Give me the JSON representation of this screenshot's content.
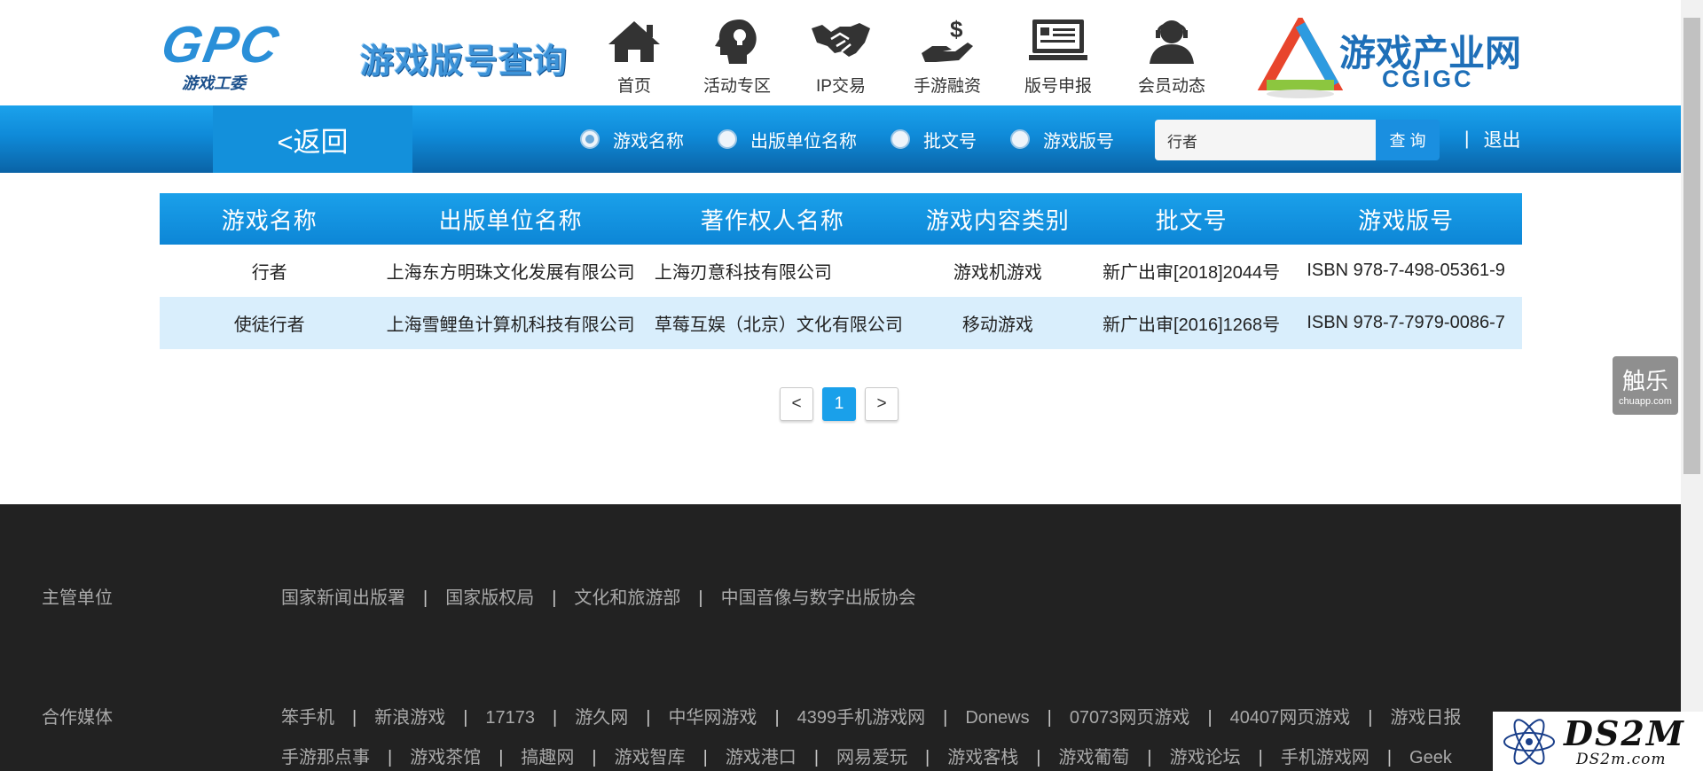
{
  "header": {
    "logo_letters": "GPC",
    "logo_sub": "游戏工委",
    "site_title": "游戏版号查询",
    "nav": [
      {
        "label": "首页",
        "icon": "home-icon"
      },
      {
        "label": "活动专区",
        "icon": "head-idea-icon"
      },
      {
        "label": "IP交易",
        "icon": "handshake-icon"
      },
      {
        "label": "手游融资",
        "icon": "money-hand-icon"
      },
      {
        "label": "版号申报",
        "icon": "monitor-icon"
      },
      {
        "label": "会员动态",
        "icon": "member-icon"
      }
    ],
    "partner_logo_text": "游戏产业网",
    "partner_logo_sub": "CGIGC"
  },
  "search": {
    "back_label": "<返回",
    "options": [
      {
        "label": "游戏名称",
        "selected": true
      },
      {
        "label": "出版单位名称",
        "selected": false
      },
      {
        "label": "批文号",
        "selected": false
      },
      {
        "label": "游戏版号",
        "selected": false
      }
    ],
    "query": "行者",
    "button_label": "查 询",
    "logout_sep": "|",
    "logout_label": "退出"
  },
  "table": {
    "columns": [
      "游戏名称",
      "出版单位名称",
      "著作权人名称",
      "游戏内容类别",
      "批文号",
      "游戏版号"
    ],
    "rows": [
      [
        "行者",
        "上海东方明珠文化发展有限公司",
        "上海刃意科技有限公司",
        "游戏机游戏",
        "新广出审[2018]2044号",
        "ISBN 978-7-498-05361-9"
      ],
      [
        "使徒行者",
        "上海雪鲤鱼计算机科技有限公司",
        "草莓互娱（北京）文化有限公司",
        "移动游戏",
        "新广出审[2016]1268号",
        "ISBN 978-7-7979-0086-7"
      ]
    ]
  },
  "pagination": {
    "prev": "<",
    "current": "1",
    "next": ">"
  },
  "side_widget": {
    "cn": "触乐",
    "en": "chuapp.com"
  },
  "footer": {
    "supervisor_label": "主管单位",
    "supervisors": [
      "国家新闻出版署",
      "国家版权局",
      "文化和旅游部",
      "中国音像与数字出版协会"
    ],
    "media_label": "合作媒体",
    "media_row1": [
      "笨手机",
      "新浪游戏",
      "17173",
      "游久网",
      "中华网游戏",
      "4399手机游戏网",
      "Donews",
      "07073网页游戏",
      "40407网页游戏",
      "游戏日报"
    ],
    "media_row2": [
      "手游那点事",
      "游戏茶馆",
      "搞趣网",
      "游戏智库",
      "游戏港口",
      "网易爱玩",
      "游戏客栈",
      "游戏葡萄",
      "游戏论坛",
      "手机游戏网",
      "Geek"
    ],
    "separator": "|"
  },
  "watermark": {
    "text": "DS2M",
    "sub": "DS2m.com"
  },
  "colors": {
    "bar_top": "#1ba2ec",
    "bar_bottom": "#0a63a6",
    "row_alt": "#d9eefc",
    "footer_bg": "#222222"
  }
}
